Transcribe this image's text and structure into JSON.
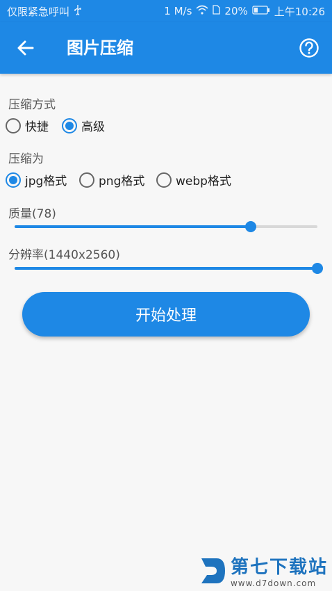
{
  "status_bar": {
    "carrier": "仅限紧急呼叫",
    "usb_icon": "usb-icon",
    "speed": "1 M/s",
    "battery": "20%",
    "time": "上午10:26"
  },
  "app_bar": {
    "title": "图片压缩",
    "back_icon": "arrow-left-icon",
    "help_icon": "help-circle-icon"
  },
  "compression_mode": {
    "label": "压缩方式",
    "options": [
      "快捷",
      "高级"
    ],
    "selected": "高级"
  },
  "format": {
    "label": "压缩为",
    "options": [
      "jpg格式",
      "png格式",
      "webp格式"
    ],
    "selected": "jpg格式"
  },
  "quality": {
    "label": "质量(78)",
    "value": 78,
    "max": 100
  },
  "resolution": {
    "label": "分辨率(1440x2560)",
    "value": 1,
    "max": 1
  },
  "start_button": {
    "label": "开始处理"
  },
  "watermark": {
    "name": "第七下载站",
    "url": "www.d7down.com"
  },
  "colors": {
    "primary": "#1e88e5",
    "background": "#f7f7f7"
  }
}
